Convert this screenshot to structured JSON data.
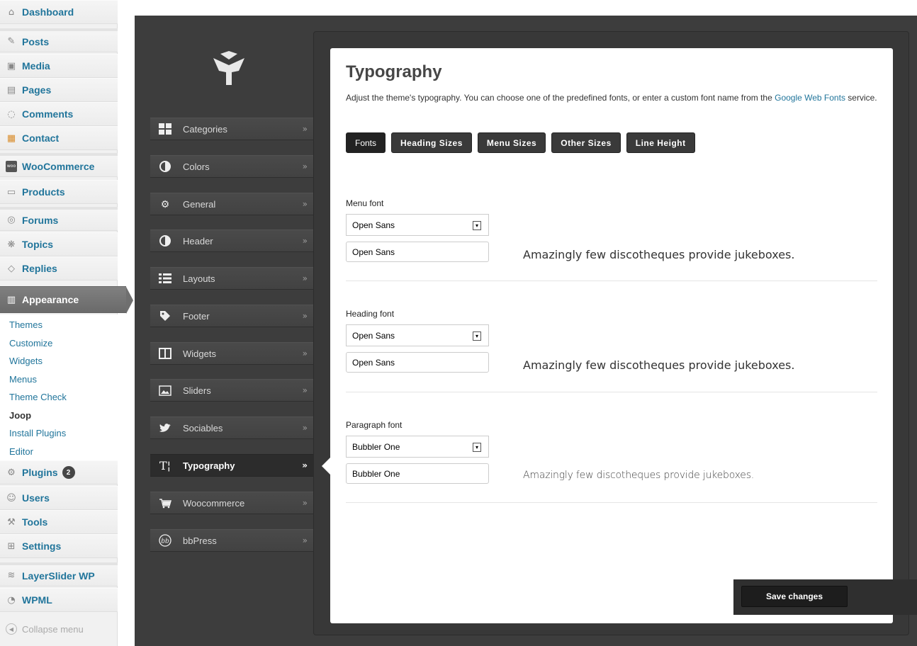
{
  "wp_menu": {
    "items": [
      {
        "label": "Dashboard",
        "icon": "dashboard-icon"
      },
      {
        "label": "Posts",
        "icon": "pin-icon"
      },
      {
        "label": "Media",
        "icon": "media-icon"
      },
      {
        "label": "Pages",
        "icon": "pages-icon"
      },
      {
        "label": "Comments",
        "icon": "comment-icon"
      },
      {
        "label": "Contact",
        "icon": "contact-icon"
      },
      {
        "label": "WooCommerce",
        "icon": "woo-icon"
      },
      {
        "label": "Products",
        "icon": "cart-icon"
      },
      {
        "label": "Forums",
        "icon": "forums-icon"
      },
      {
        "label": "Topics",
        "icon": "topics-icon"
      },
      {
        "label": "Replies",
        "icon": "replies-icon"
      },
      {
        "label": "Appearance",
        "icon": "appearance-icon"
      },
      {
        "label": "Plugins",
        "icon": "plugin-icon",
        "badge": "2"
      },
      {
        "label": "Users",
        "icon": "users-icon"
      },
      {
        "label": "Tools",
        "icon": "tools-icon"
      },
      {
        "label": "Settings",
        "icon": "settings-icon"
      },
      {
        "label": "LayerSlider WP",
        "icon": "layerslider-icon"
      },
      {
        "label": "WPML",
        "icon": "wpml-icon"
      }
    ],
    "submenu": [
      "Themes",
      "Customize",
      "Widgets",
      "Menus",
      "Theme Check",
      "Joop",
      "Install Plugins",
      "Editor"
    ],
    "current_submenu": "Joop",
    "collapse_label": "Collapse menu"
  },
  "theme_nav": [
    {
      "label": "Categories",
      "icon": "grid-icon"
    },
    {
      "label": "Colors",
      "icon": "contrast-icon"
    },
    {
      "label": "General",
      "icon": "gears-icon"
    },
    {
      "label": "Header",
      "icon": "contrast-icon"
    },
    {
      "label": "Layouts",
      "icon": "list-icon"
    },
    {
      "label": "Footer",
      "icon": "tag-icon"
    },
    {
      "label": "Widgets",
      "icon": "columns-icon"
    },
    {
      "label": "Sliders",
      "icon": "image-icon"
    },
    {
      "label": "Sociables",
      "icon": "twitter-icon"
    },
    {
      "label": "Typography",
      "icon": "typography-icon"
    },
    {
      "label": "Woocommerce",
      "icon": "cart-icon"
    },
    {
      "label": "bbPress",
      "icon": "bbpress-icon"
    }
  ],
  "active_nav": "Typography",
  "chevron": "»",
  "main": {
    "title": "Typography",
    "description_before": "Adjust the theme's typography. You can choose one of the predefined fonts, or enter a custom font name from the ",
    "description_link": "Google Web Fonts",
    "description_after": " service.",
    "tabs": [
      "Fonts",
      "Heading Sizes",
      "Menu Sizes",
      "Other Sizes",
      "Line Height"
    ],
    "sections": [
      {
        "label": "Menu font",
        "select": "Open Sans",
        "input": "Open Sans",
        "preview": "Amazingly few discotheques provide jukeboxes."
      },
      {
        "label": "Heading font",
        "select": "Open Sans",
        "input": "Open Sans",
        "preview": "Amazingly few discotheques provide jukeboxes."
      },
      {
        "label": "Paragraph font",
        "select": "Bubbler One",
        "input": "Bubbler One",
        "preview": "Amazingly few discotheques provide jukeboxes."
      }
    ],
    "save_label": "Save changes"
  },
  "colors": {
    "link": "#21759b",
    "panel": "#3d3d3d",
    "active_menu": "#6f6f6f"
  }
}
